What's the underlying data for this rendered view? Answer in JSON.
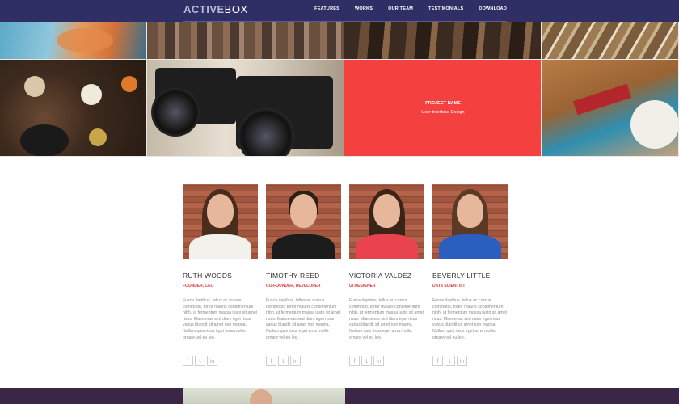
{
  "header": {
    "logo_part1": "ACTIVE",
    "logo_part2": "BOX",
    "nav": [
      "FEATURES",
      "WORKS",
      "OUR TEAM",
      "TESTIMONIALS",
      "DOWNLOAD"
    ]
  },
  "portfolio": {
    "overlay_title": "PROJECT NAME",
    "overlay_subtitle": "User Interface Design"
  },
  "team": [
    {
      "name": "RUTH WOODS",
      "role": "FOUNDER, CEO",
      "bio": "Fusce dapibus, tellus ac cursus commodo, tortor mauris condimentum nibh, ut fermentum massa justo sit amet risus. Maecenas sed diam eget risus varius blandit sit amet non magna. Nullam quis risus eget urna mollis ornare vel eu leo."
    },
    {
      "name": "TIMOTHY REED",
      "role": "CO-FOUNDER, DEVELOPER",
      "bio": "Fusce dapibus, tellus ac cursus commodo, tortor mauris condimentum nibh, ut fermentum massa justo sit amet risus. Maecenas sed diam eget risus varius blandit sit amet non magna. Nullam quis risus eget urna mollis ornare vel eu leo."
    },
    {
      "name": "VICTORIA VALDEZ",
      "role": "UI DESIGNER",
      "bio": "Fusce dapibus, tellus ac cursus commodo, tortor mauris condimentum nibh, ut fermentum massa justo sit amet risus. Maecenas sed diam eget risus varius blandit sit amet non magna. Nullam quis risus eget urna mollis ornare vel eu leo."
    },
    {
      "name": "BEVERLY LITTLE",
      "role": "DATA SCIENTIST",
      "bio": "Fusce dapibus, tellus ac cursus commodo, tortor mauris condimentum nibh, ut fermentum massa justo sit amet risus. Maecenas sed diam eget risus varius blandit sit amet non magna. Nullam quis risus eget urna mollis ornare vel eu leo."
    }
  ],
  "social_icons": {
    "facebook": "f",
    "twitter": "t",
    "linkedin": "in"
  },
  "colors": {
    "header_bg": "#2f2f66",
    "accent_red": "#e0393b",
    "overlay_red": "#f4413f",
    "footer_bg": "#3a2747"
  }
}
